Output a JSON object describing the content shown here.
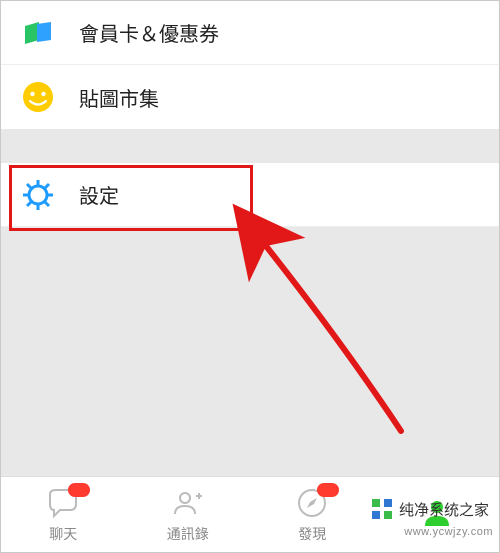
{
  "menu": {
    "items": [
      {
        "id": "membership",
        "label": "會員卡＆優惠券",
        "icon": "wallet-icon"
      },
      {
        "id": "sticker-market",
        "label": "貼圖市集",
        "icon": "smiley-icon"
      }
    ]
  },
  "settings": {
    "label": "設定",
    "icon": "gear-icon"
  },
  "tabbar": {
    "items": [
      {
        "id": "chat",
        "label": "聊天",
        "icon": "chat-icon",
        "badge": true
      },
      {
        "id": "contacts",
        "label": "通訊錄",
        "icon": "contacts-icon",
        "badge": false
      },
      {
        "id": "discover",
        "label": "發現",
        "icon": "compass-icon",
        "badge": true
      },
      {
        "id": "me",
        "label": "",
        "icon": "person-icon",
        "badge": false,
        "active": true
      }
    ]
  },
  "watermark": {
    "text": "纯净系统之家",
    "url": "www.ycwjzy.com"
  },
  "annotation": {
    "highlight_target": "settings-row",
    "arrow": true
  }
}
